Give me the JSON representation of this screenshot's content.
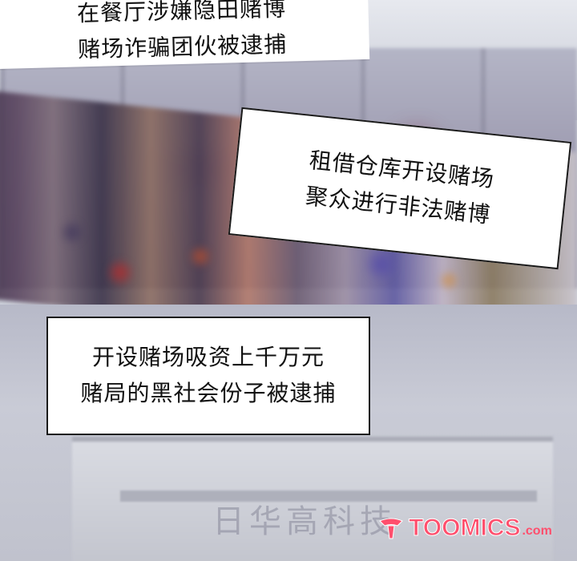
{
  "captions": {
    "top": {
      "line1": "在餐厅涉嫌隐田赌博",
      "line2": "赌场诈骗团伙被逮捕"
    },
    "mid": {
      "line1": "租借仓库开设赌场",
      "line2": "聚众进行非法赌博"
    },
    "bottom": {
      "line1": "开设赌场吸资上千万元",
      "line2": "赌局的黑社会份子被逮捕"
    }
  },
  "watermark": {
    "cn_text": "日华高科技",
    "logo_text": "TOOMICS",
    "logo_suffix": ".com",
    "logo_color": "#ff4f6d"
  }
}
